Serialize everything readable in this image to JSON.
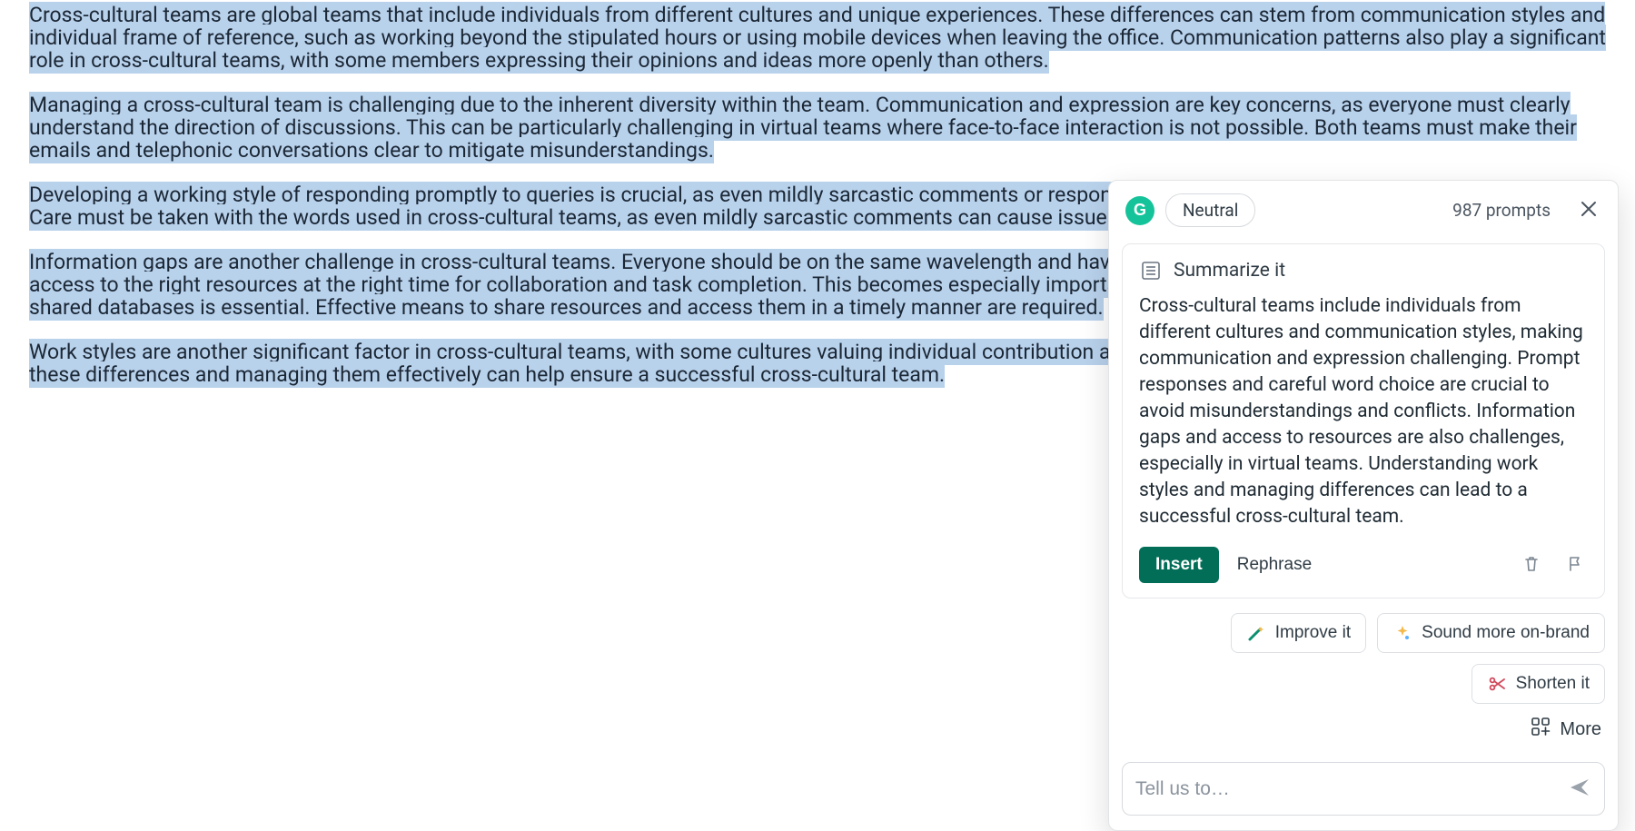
{
  "article": {
    "paragraphs": [
      "Cross-cultural teams are global teams that include individuals from different cultures and unique experiences. These differences can stem from communication styles and individual frame of reference, such as working beyond the stipulated hours or using mobile devices when leaving the office. Communication patterns also play a significant role in cross-cultural teams, with some members expressing their opinions and ideas more openly than others.",
      "Managing a cross-cultural team is challenging due to the inherent diversity within the team. Communication and expression are key concerns, as everyone must clearly understand the direction of discussions. This can be particularly challenging in virtual teams where face-to-face interaction is not possible. Both teams must make their emails and telephonic conversations clear to mitigate misunderstandings.",
      "Developing a working style of responding promptly to queries is crucial, as even mildly sarcastic comments or responses can lead to misunderstandings and conflicts. Care must be taken with the words used in cross-cultural teams, as even mildly sarcastic comments can cause issues.",
      "Information gaps are another challenge in cross-cultural teams. Everyone should be on the same wavelength and have the same understanding. Each member needs access to the right resources at the right time for collaboration and task completion. This becomes especially important in virtual teams, so using common software and shared databases is essential. Effective means to share resources and access them in a timely manner are required.",
      "Work styles are another significant factor in cross-cultural teams, with some cultures valuing individual contribution and others emphasizing group effort. Understanding these differences and managing them effectively can help ensure a successful cross-cultural team."
    ]
  },
  "panel": {
    "logo_letter": "G",
    "tone_label": "Neutral",
    "prompts_count": "987 prompts",
    "card": {
      "title": "Summarize it",
      "summary": "Cross-cultural teams include individuals from different cultures and communication styles, making communication and expression challenging. Prompt responses and careful word choice are crucial to avoid misunderstandings and conflicts. Information gaps and access to resources are also challenges, especially in virtual teams. Understanding work styles and managing differences can lead to a successful cross-cultural team.",
      "insert_label": "Insert",
      "rephrase_label": "Rephrase"
    },
    "chips": {
      "improve": "Improve it",
      "onbrand": "Sound more on-brand",
      "shorten": "Shorten it"
    },
    "more_label": "More",
    "prompt_placeholder": "Tell us to…"
  },
  "colors": {
    "highlight": "#b9d2ec",
    "accent_green": "#15C39A",
    "primary_button": "#026e58"
  }
}
